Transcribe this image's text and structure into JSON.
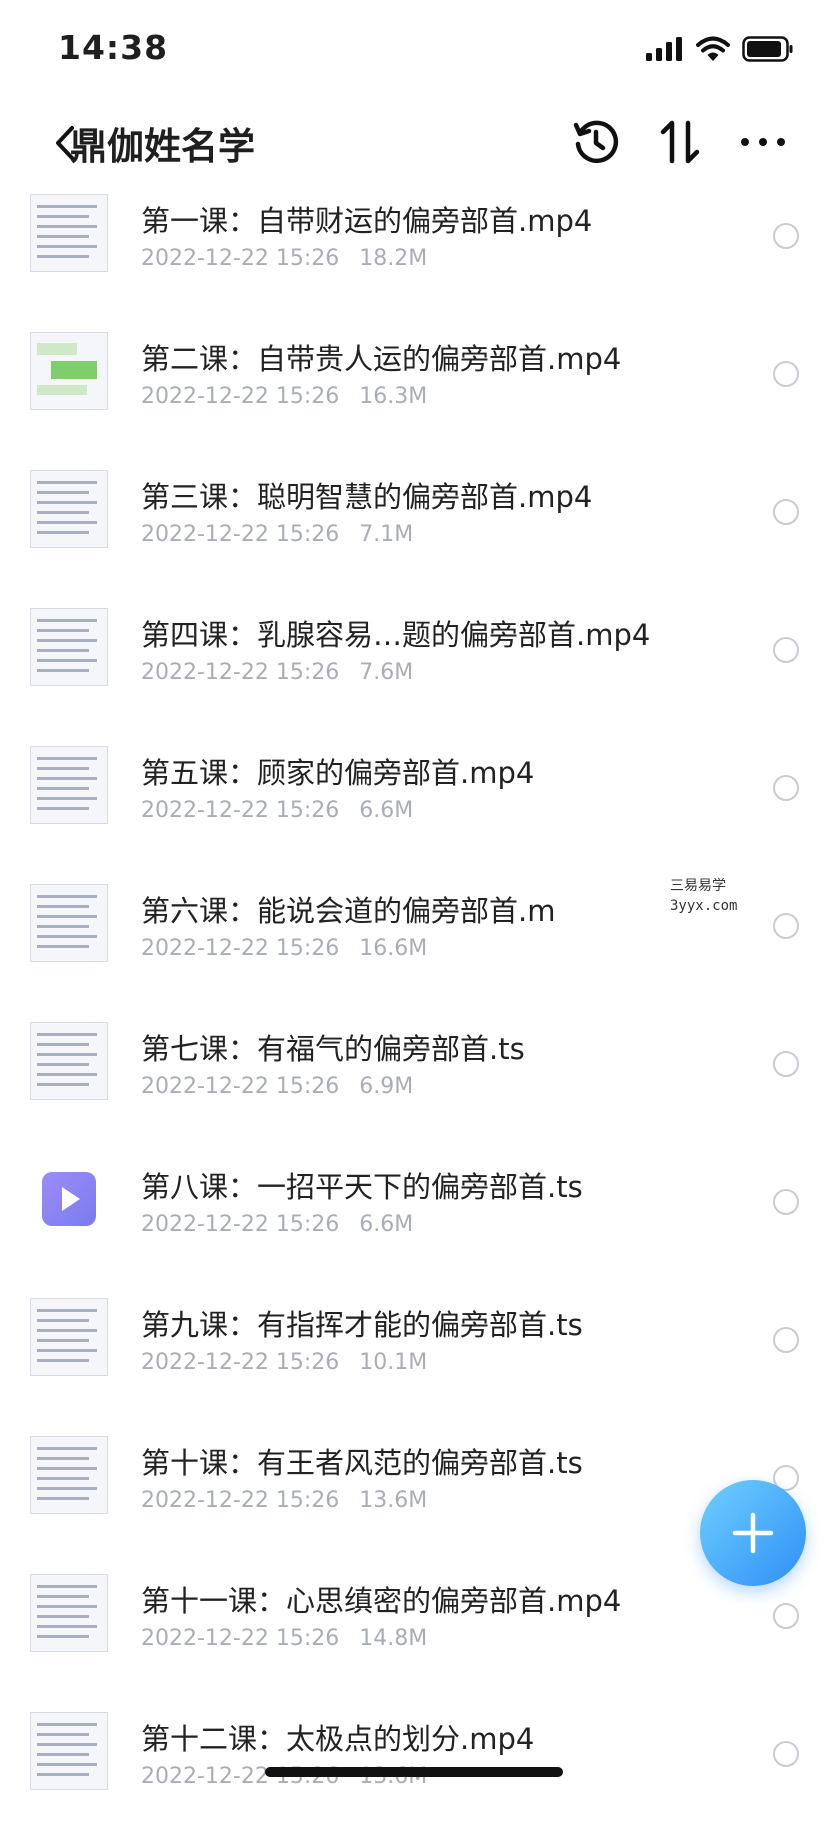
{
  "status": {
    "time": "14:38"
  },
  "header": {
    "title": "鼎伽姓名学"
  },
  "files": [
    {
      "name": "第一课：自带财运的偏旁部首.mp4",
      "date": "2022-12-22 15:26",
      "size": "18.2M",
      "thumb": "document"
    },
    {
      "name": "第二课：自带贵人运的偏旁部首.mp4",
      "date": "2022-12-22 15:26",
      "size": "16.3M",
      "thumb": "chat-screenshot"
    },
    {
      "name": "第三课：聪明智慧的偏旁部首.mp4",
      "date": "2022-12-22 15:26",
      "size": "7.1M",
      "thumb": "document"
    },
    {
      "name": "第四课：乳腺容易…题的偏旁部首.mp4",
      "date": "2022-12-22 15:26",
      "size": "7.6M",
      "thumb": "document"
    },
    {
      "name": "第五课：顾家的偏旁部首.mp4",
      "date": "2022-12-22 15:26",
      "size": "6.6M",
      "thumb": "document"
    },
    {
      "name": "第六课：能说会道的偏旁部首.m",
      "date": "2022-12-22 15:26",
      "size": "16.6M",
      "thumb": "document"
    },
    {
      "name": "第七课：有福气的偏旁部首.ts",
      "date": "2022-12-22 15:26",
      "size": "6.9M",
      "thumb": "document"
    },
    {
      "name": "第八课：一招平天下的偏旁部首.ts",
      "date": "2022-12-22 15:26",
      "size": "6.6M",
      "thumb": "video-icon"
    },
    {
      "name": "第九课：有指挥才能的偏旁部首.ts",
      "date": "2022-12-22 15:26",
      "size": "10.1M",
      "thumb": "document"
    },
    {
      "name": "第十课：有王者风范的偏旁部首.ts",
      "date": "2022-12-22 15:26",
      "size": "13.6M",
      "thumb": "document"
    },
    {
      "name": "第十一课：心思缜密的偏旁部首.mp4",
      "date": "2022-12-22 15:26",
      "size": "14.8M",
      "thumb": "document"
    },
    {
      "name": "第十二课：太极点的划分.mp4",
      "date": "2022-12-22 15:26",
      "size": "13.6M",
      "thumb": "document"
    }
  ],
  "watermark": {
    "line1": "三易易学",
    "line2": "3yyx.com"
  },
  "icons": {
    "back": "chevron-left-icon",
    "history": "history-icon",
    "sort": "sort-icon",
    "more": "more-icon",
    "add": "plus-icon"
  },
  "colors": {
    "accent": "#2f8ff6",
    "meta_text": "#a9adb5",
    "video_icon": "#8b84f3"
  }
}
